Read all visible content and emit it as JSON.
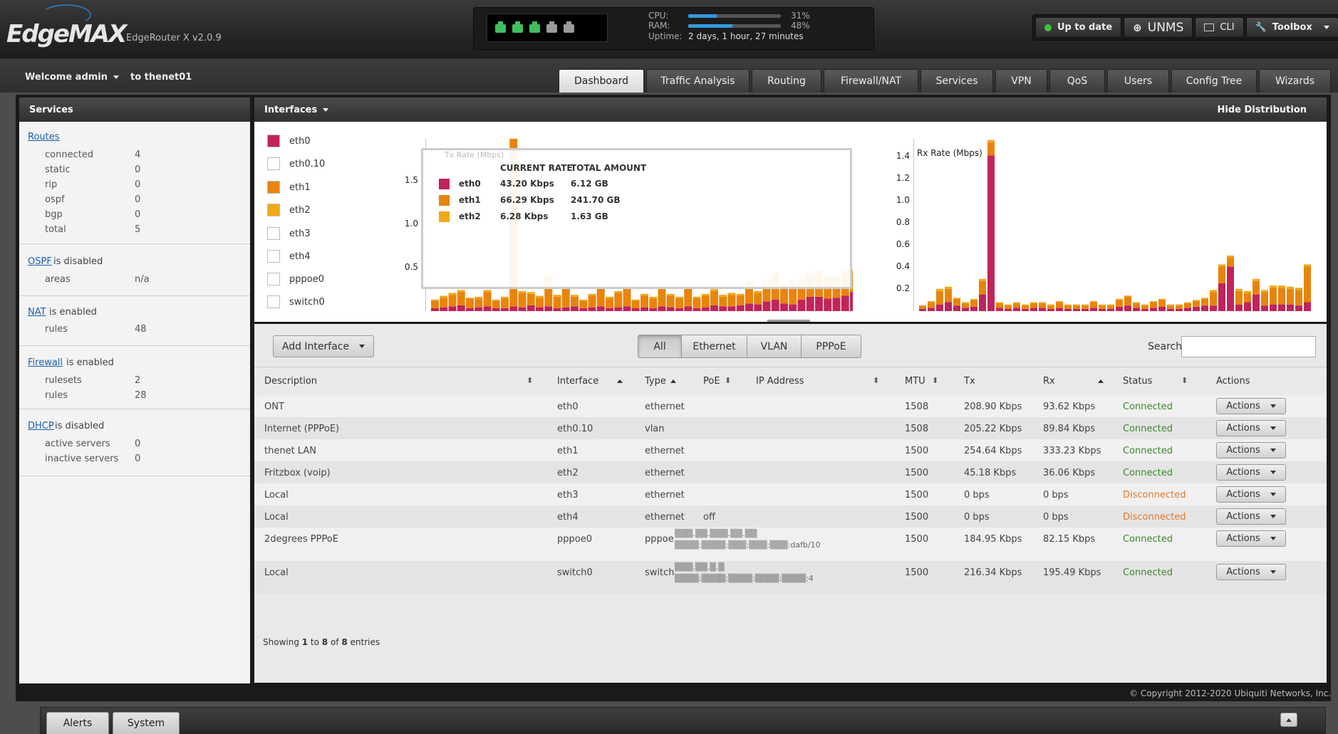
{
  "header": {
    "logo": "EdgeMAX",
    "device": "EdgeRouter X v2.0.9",
    "cpu_label": "CPU:",
    "cpu_pct": "31%",
    "cpu_value": 0.31,
    "ram_label": "RAM:",
    "ram_pct": "48%",
    "ram_value": 0.48,
    "uptime_label": "Uptime:",
    "uptime_value": "2 days, 1 hour, 27 minutes",
    "ports": [
      {
        "name": "eth0",
        "color": "#3fbf5f"
      },
      {
        "name": "eth1",
        "color": "#3fbf5f"
      },
      {
        "name": "eth2",
        "color": "#3fbf5f"
      },
      {
        "name": "eth3",
        "color": "#9a9a9a"
      },
      {
        "name": "eth4",
        "color": "#9a9a9a"
      }
    ],
    "buttons": {
      "update": "Up to date",
      "unms": "UNMS",
      "cli": "CLI",
      "toolbox": "Toolbox"
    }
  },
  "user": {
    "welcome": "Welcome admin",
    "to": "to thenet01"
  },
  "tabs": [
    "Dashboard",
    "Traffic Analysis",
    "Routing",
    "Firewall/NAT",
    "Services",
    "VPN",
    "QoS",
    "Users",
    "Config Tree",
    "Wizards"
  ],
  "sidebar": {
    "title": "Services",
    "routes": {
      "link": "Routes",
      "items": [
        {
          "k": "connected",
          "v": "4"
        },
        {
          "k": "static",
          "v": "0"
        },
        {
          "k": "rip",
          "v": "0"
        },
        {
          "k": "ospf",
          "v": "0"
        },
        {
          "k": "bgp",
          "v": "0"
        },
        {
          "k": "total",
          "v": "5"
        }
      ]
    },
    "ospf": {
      "link": "OSPF",
      "status": "is disabled",
      "k": "areas",
      "v": "n/a"
    },
    "nat": {
      "link": "NAT",
      "status": "is enabled",
      "k": "rules",
      "v": "48"
    },
    "firewall": {
      "link": "Firewall",
      "status": "is enabled",
      "items": [
        {
          "k": "rulesets",
          "v": "2"
        },
        {
          "k": "rules",
          "v": "28"
        }
      ]
    },
    "dhcp": {
      "link": "DHCP",
      "status": "is disabled",
      "items": [
        {
          "k": "active servers",
          "v": "0"
        },
        {
          "k": "inactive servers",
          "v": "0"
        }
      ]
    }
  },
  "interfaces_panel": {
    "title": "Interfaces",
    "hide": "Hide Distribution",
    "legend": [
      {
        "name": "eth0",
        "color": "#c0245a",
        "on": true
      },
      {
        "name": "eth0.10",
        "color": "#ffffff",
        "on": false
      },
      {
        "name": "eth1",
        "color": "#e8840c",
        "on": true
      },
      {
        "name": "eth2",
        "color": "#f0a81a",
        "on": true
      },
      {
        "name": "eth3",
        "color": "#ffffff",
        "on": false
      },
      {
        "name": "eth4",
        "color": "#ffffff",
        "on": false
      },
      {
        "name": "pppoe0",
        "color": "#ffffff",
        "on": false
      },
      {
        "name": "switch0",
        "color": "#ffffff",
        "on": false
      }
    ],
    "tooltip": {
      "h1": "CURRENT RATE",
      "h2": "TOTAL AMOUNT",
      "rows": [
        {
          "name": "eth0",
          "rate": "43.20 Kbps",
          "total": "6.12 GB",
          "color": "#c0245a"
        },
        {
          "name": "eth1",
          "rate": "66.29 Kbps",
          "total": "241.70 GB",
          "color": "#e8840c"
        },
        {
          "name": "eth2",
          "rate": "6.28 Kbps",
          "total": "1.63 GB",
          "color": "#f0a81a"
        }
      ]
    }
  },
  "chart_data": [
    {
      "type": "bar",
      "title": "Tx Rate (Mbps)",
      "stacked": true,
      "ylim": [
        0,
        1.8
      ],
      "yticks": [
        "1.5",
        "1.0",
        "0.5"
      ],
      "series": [
        {
          "name": "eth0",
          "color": "#c0245a",
          "values": [
            0.03,
            0.04,
            0.05,
            0.06,
            0.03,
            0.04,
            0.05,
            0.03,
            0.03,
            0.05,
            0.04,
            0.06,
            0.04,
            0.05,
            0.03,
            0.04,
            0.05,
            0.03,
            0.04,
            0.05,
            0.03,
            0.04,
            0.05,
            0.03,
            0.04,
            0.03,
            0.05,
            0.04,
            0.03,
            0.05,
            0.03,
            0.04,
            0.06,
            0.05,
            0.05,
            0.06,
            0.08,
            0.07,
            0.1,
            0.12,
            0.08,
            0.07,
            0.12,
            0.15,
            0.15,
            0.13,
            0.14,
            0.16,
            0.2
          ]
        },
        {
          "name": "eth1",
          "color": "#e8840c",
          "values": [
            0.08,
            0.1,
            0.12,
            0.14,
            0.1,
            0.09,
            0.15,
            0.08,
            0.1,
            1.8,
            0.15,
            0.12,
            0.1,
            0.3,
            0.12,
            0.2,
            0.1,
            0.08,
            0.12,
            0.2,
            0.1,
            0.15,
            0.2,
            0.08,
            0.12,
            0.1,
            0.18,
            0.12,
            0.1,
            0.2,
            0.1,
            0.12,
            0.15,
            0.1,
            0.12,
            0.1,
            0.2,
            0.12,
            0.2,
            0.25,
            0.18,
            0.22,
            0.2,
            0.22,
            0.25,
            0.2,
            0.2,
            0.25,
            0.2
          ]
        },
        {
          "name": "eth2",
          "color": "#f0a81a",
          "values": [
            0.01,
            0.02,
            0.02,
            0.02,
            0.01,
            0.02,
            0.02,
            0.01,
            0.02,
            0.03,
            0.02,
            0.02,
            0.02,
            0.03,
            0.02,
            0.02,
            0.02,
            0.01,
            0.02,
            0.02,
            0.02,
            0.02,
            0.02,
            0.01,
            0.02,
            0.02,
            0.02,
            0.02,
            0.02,
            0.02,
            0.02,
            0.02,
            0.02,
            0.02,
            0.02,
            0.02,
            0.03,
            0.02,
            0.03,
            0.03,
            0.02,
            0.03,
            0.03,
            0.03,
            0.03,
            0.03,
            0.03,
            0.03,
            0.03
          ]
        }
      ]
    },
    {
      "type": "bar",
      "title": "Rx Rate (Mbps)",
      "stacked": true,
      "ylim": [
        0,
        1.55
      ],
      "yticks": [
        "1.4",
        "1.2",
        "1.0",
        "0.8",
        "0.6",
        "0.4",
        "0.2"
      ],
      "series": [
        {
          "name": "eth0",
          "color": "#c0245a",
          "values": [
            0.02,
            0.03,
            0.06,
            0.08,
            0.05,
            0.03,
            0.04,
            0.15,
            1.4,
            0.03,
            0.02,
            0.03,
            0.02,
            0.03,
            0.03,
            0.02,
            0.03,
            0.02,
            0.02,
            0.02,
            0.03,
            0.02,
            0.02,
            0.04,
            0.05,
            0.03,
            0.02,
            0.03,
            0.04,
            0.02,
            0.02,
            0.03,
            0.04,
            0.05,
            0.05,
            0.25,
            0.4,
            0.06,
            0.08,
            0.15,
            0.05,
            0.06,
            0.06,
            0.06,
            0.05,
            0.08
          ]
        },
        {
          "name": "eth1",
          "color": "#e8840c",
          "values": [
            0.03,
            0.05,
            0.12,
            0.12,
            0.06,
            0.04,
            0.06,
            0.12,
            0.12,
            0.04,
            0.03,
            0.04,
            0.03,
            0.04,
            0.04,
            0.03,
            0.05,
            0.03,
            0.03,
            0.03,
            0.05,
            0.03,
            0.03,
            0.06,
            0.08,
            0.04,
            0.03,
            0.05,
            0.06,
            0.03,
            0.03,
            0.04,
            0.05,
            0.06,
            0.12,
            0.15,
            0.08,
            0.12,
            0.08,
            0.12,
            0.12,
            0.15,
            0.15,
            0.14,
            0.14,
            0.32
          ]
        },
        {
          "name": "eth2",
          "color": "#f0a81a",
          "values": [
            0.0,
            0.01,
            0.02,
            0.02,
            0.01,
            0.01,
            0.01,
            0.02,
            0.02,
            0.01,
            0.01,
            0.01,
            0.01,
            0.01,
            0.01,
            0.01,
            0.01,
            0.01,
            0.01,
            0.01,
            0.01,
            0.01,
            0.01,
            0.01,
            0.01,
            0.01,
            0.01,
            0.01,
            0.01,
            0.01,
            0.01,
            0.01,
            0.01,
            0.01,
            0.02,
            0.02,
            0.02,
            0.02,
            0.02,
            0.02,
            0.02,
            0.02,
            0.02,
            0.02,
            0.02,
            0.02
          ]
        }
      ]
    }
  ],
  "toolbar": {
    "add_interface": "Add Interface",
    "filters": [
      "All",
      "Ethernet",
      "VLAN",
      "PPPoE"
    ],
    "search_label": "Search"
  },
  "table": {
    "headers": [
      "Description",
      "Interface",
      "Type",
      "PoE",
      "IP Address",
      "MTU",
      "Tx",
      "Rx",
      "Status",
      "Actions"
    ],
    "rows": [
      {
        "desc": "ONT",
        "iface": "eth0",
        "type": "ethernet",
        "poe": "",
        "ip1": "",
        "ip2": "",
        "mtu": "1508",
        "tx": "208.90 Kbps",
        "rx": "93.62 Kbps",
        "status": "Connected",
        "action": "Actions"
      },
      {
        "desc": "Internet (PPPoE)",
        "iface": "eth0.10",
        "type": "vlan",
        "poe": "",
        "ip1": "",
        "ip2": "",
        "mtu": "1508",
        "tx": "205.22 Kbps",
        "rx": "89.84 Kbps",
        "status": "Connected",
        "action": "Actions"
      },
      {
        "desc": "thenet LAN",
        "iface": "eth1",
        "type": "ethernet",
        "poe": "",
        "ip1": "",
        "ip2": "",
        "mtu": "1500",
        "tx": "254.64 Kbps",
        "rx": "333.23 Kbps",
        "status": "Connected",
        "action": "Actions"
      },
      {
        "desc": "Fritzbox (voip)",
        "iface": "eth2",
        "type": "ethernet",
        "poe": "",
        "ip1": "",
        "ip2": "",
        "mtu": "1500",
        "tx": "45.18 Kbps",
        "rx": "36.06 Kbps",
        "status": "Connected",
        "action": "Actions"
      },
      {
        "desc": "Local",
        "iface": "eth3",
        "type": "ethernet",
        "poe": "",
        "ip1": "",
        "ip2": "",
        "mtu": "1500",
        "tx": "0 bps",
        "rx": "0 bps",
        "status": "Disconnected",
        "action": "Actions"
      },
      {
        "desc": "Local",
        "iface": "eth4",
        "type": "ethernet",
        "poe": "off",
        "ip1": "",
        "ip2": "",
        "mtu": "1500",
        "tx": "0 bps",
        "rx": "0 bps",
        "status": "Disconnected",
        "action": "Actions"
      },
      {
        "desc": "2degrees PPPoE",
        "iface": "pppoe0",
        "type": "pppoe",
        "poe": "",
        "ip1": "▒▒▒.▒▒.▒▒▒.▒▒.▒▒",
        "ip2": "▒▒▒▒:▒▒▒▒:▒▒▒:▒▒▒:▒▒▒:dafb/10",
        "mtu": "1500",
        "tx": "184.95 Kbps",
        "rx": "82.15 Kbps",
        "status": "Connected",
        "action": "Actions"
      },
      {
        "desc": "Local",
        "iface": "switch0",
        "type": "switch",
        "poe": "",
        "ip1": "▒▒▒.▒▒.▒.▒",
        "ip2": "▒▒▒▒:▒▒▒▒:▒▒▒▒:▒▒▒▒:▒▒▒▒:4",
        "mtu": "1500",
        "tx": "216.34 Kbps",
        "rx": "195.49 Kbps",
        "status": "Connected",
        "action": "Actions"
      }
    ],
    "footer_pre": "Showing ",
    "footer_from": "1",
    "footer_mid": " to ",
    "footer_to": "8",
    "footer_of": " of ",
    "footer_total": "8",
    "footer_post": " entries"
  },
  "colors": {
    "connected": "#3a8a2a",
    "disconnected": "#e0792a",
    "link": "#1a5fa8"
  },
  "footer": {
    "copyright": "© Copyright 2012-2020 Ubiquiti Networks, Inc.",
    "alerts": "Alerts",
    "system": "System"
  }
}
